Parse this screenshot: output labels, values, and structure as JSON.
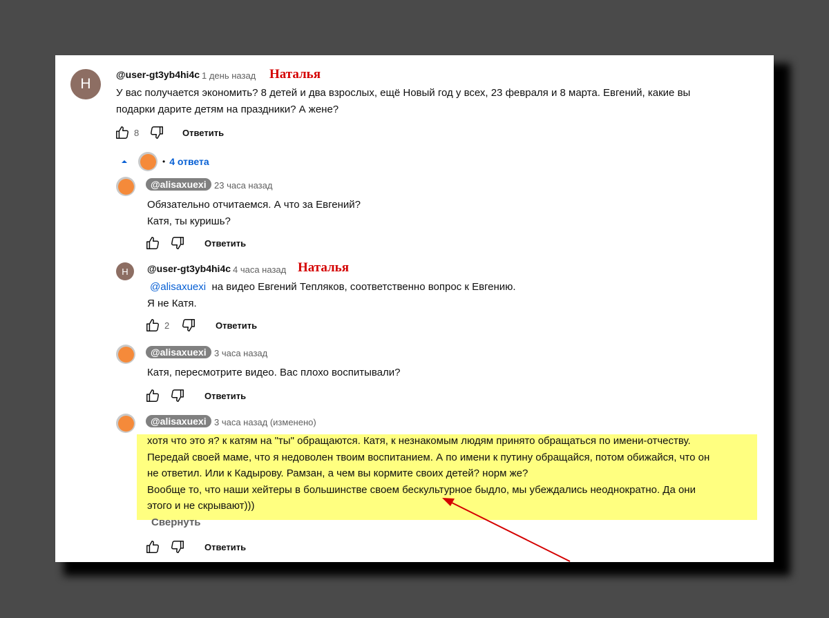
{
  "comment": {
    "avatar_letter": "H",
    "author": "@user-gt3yb4hi4c",
    "time": "1 день назад",
    "note": "Наталья",
    "text_line1": "У вас получается экономить? 8 детей и два взрослых, ещё Новый год у всех, 23 февраля и 8 марта.  Евгений, какие вы",
    "text_line2": "подарки дарите детям на праздники? А жене?",
    "likes": "8",
    "reply_label": "Ответить"
  },
  "replies_toggle": {
    "label": "4 ответа",
    "separator": "•"
  },
  "replies": [
    {
      "author": "@alisaxuexi",
      "time": "23 часа назад",
      "line1": "Обязательно отчитаемся. А что за Евгений?",
      "line2": "Катя, ты куришь?",
      "reply_label": "Ответить"
    },
    {
      "avatar_letter": "H",
      "author": "@user-gt3yb4hi4c",
      "time": "4 часа назад",
      "note": "Наталья",
      "mention": "@alisaxuexi",
      "line1_rest": "на видео Евгений Тепляков, соответственно вопрос к Евгению.",
      "line2": "Я не Катя.",
      "likes": "2",
      "reply_label": "Ответить"
    },
    {
      "author": "@alisaxuexi",
      "time": "3 часа назад",
      "line1": "Катя, пересмотрите видео. Вас плохо воспитывали?",
      "reply_label": "Ответить"
    },
    {
      "author": "@alisaxuexi",
      "time": "3 часа назад (изменено)",
      "lines": [
        "хотя что это я? к катям на \"ты\" обращаются. Катя, к незнакомым людям принято обращаться по имени-отчеству.",
        "Передай своей маме, что я недоволен твоим воспитанием. А по имени к путину обращайся, потом обижайся, что он",
        "не ответил. Или к Кадырову. Рамзан, а чем вы кормите своих детей? норм же?",
        "Вообще то, что наши хейтеры в большинстве своем бескультурное быдло, мы убеждались неоднократно. Да они",
        "этого и не скрывают)))"
      ],
      "collapse_label": "Свернуть",
      "reply_label": "Ответить"
    }
  ],
  "colors": {
    "background": "#4a4a4a",
    "panel": "#ffffff",
    "highlight": "#ffff80",
    "annotation_red": "#d40000",
    "link_blue": "#065fd4",
    "avatar_letter_bg": "#8d6e63",
    "avatar_orange": "#f58a3a"
  },
  "icons": [
    "thumb-up-icon",
    "thumb-down-icon",
    "chevron-up-icon",
    "red-arrow-annotation"
  ]
}
